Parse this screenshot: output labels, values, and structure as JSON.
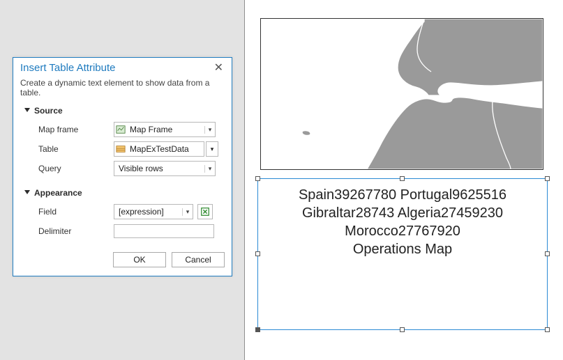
{
  "dialog": {
    "title": "Insert Table Attribute",
    "subtitle": "Create a dynamic text element to show data from a table.",
    "sections": {
      "source": "Source",
      "appearance": "Appearance"
    },
    "labels": {
      "map_frame": "Map frame",
      "table": "Table",
      "query": "Query",
      "field": "Field",
      "delimiter": "Delimiter"
    },
    "values": {
      "map_frame": "Map Frame",
      "table": "MapExTestData",
      "query": "Visible rows",
      "field": "[expression]",
      "delimiter": ""
    },
    "buttons": {
      "ok": "OK",
      "cancel": "Cancel"
    }
  },
  "preview": {
    "text_lines": [
      "Spain39267780 Portugal9625516",
      "Gibraltar28743 Algeria27459230",
      "Morocco27767920",
      "Operations Map"
    ]
  }
}
